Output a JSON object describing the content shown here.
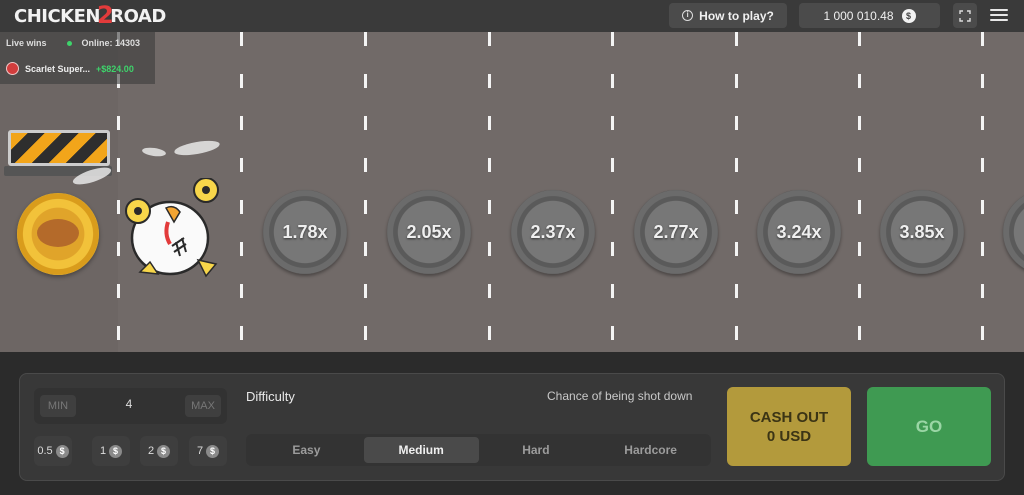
{
  "header": {
    "logo_left": "CHICKEN",
    "logo_num": "2",
    "logo_right": "ROAD",
    "how_to_play": "How to play?",
    "balance": "1 000 010.48",
    "currency_symbol": "$"
  },
  "live": {
    "title": "Live wins",
    "online": "Online: 14303",
    "winner_name": "Scarlet Super...",
    "winner_amount": "+$824.00"
  },
  "multipliers": [
    "1.78x",
    "2.05x",
    "2.37x",
    "2.77x",
    "3.24x",
    "3.85x"
  ],
  "bet": {
    "min_label": "MIN",
    "max_label": "MAX",
    "value": "4",
    "chips": [
      "0.5",
      "1",
      "2",
      "7"
    ]
  },
  "difficulty": {
    "label": "Difficulty",
    "chance_label": "Chance of being shot down",
    "options": [
      "Easy",
      "Medium",
      "Hard",
      "Hardcore"
    ],
    "selected": "Medium"
  },
  "actions": {
    "cash_out_line1": "CASH OUT",
    "cash_out_line2": "0 USD",
    "go": "GO"
  },
  "colors": {
    "road": "#716a68",
    "cash_out": "#b39a3c",
    "go": "#3f9a52",
    "win_green": "#3ed46b"
  }
}
